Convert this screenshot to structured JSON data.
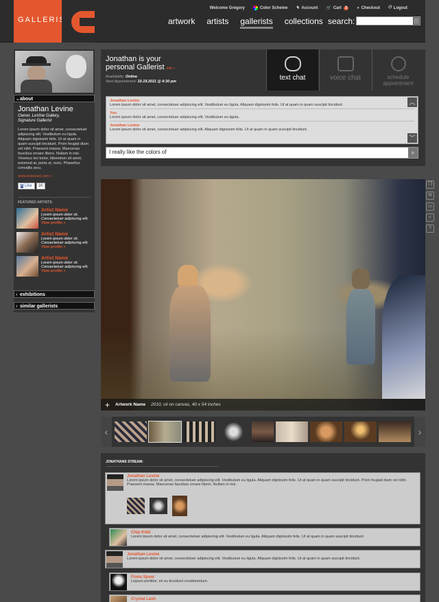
{
  "brand": {
    "name": "GALLERIST",
    "accent": "#e4572e"
  },
  "toplinks": {
    "welcome": "Welcome Gregory",
    "color_scheme": "Color Scheme",
    "account": "Account",
    "cart": "Cart",
    "cart_count": "3",
    "checkout": "Checkout",
    "logout": "Logout"
  },
  "nav": {
    "items": [
      "artwork",
      "artists",
      "gallerists",
      "collections"
    ],
    "active": "gallerists"
  },
  "search": {
    "label": "search:",
    "value": ""
  },
  "sidebar": {
    "about_label": "about",
    "name": "Jonathan Levine",
    "title_lines": [
      "Owner, LeVine Gallery,",
      "Signature Gallerist"
    ],
    "bio": "Lorem ipsum dolor sit amet, consectetuer adipiscing elit. Vestibulum eu ligula. Aliquam dignissim felis. Ut at quam in quam suscipit tincidunt. Proin feugiat diam vel nibh. Praesent massa. Maecenas faucibus ornare libero. Nullam in nisi. Vivamus leo tortor, bibendum sit amet, euismod at, porta ut, nunc. Phasellus convallis arcu.",
    "website": "www.levineart.com »",
    "fb_like": "Like",
    "fb_count": "1K",
    "featured_heading": "FEATURED ARTISTS:",
    "artists": [
      {
        "name": "Artist Name",
        "desc": "Lorem ipsum dolor sit. Consectetuer adipiscing elit.",
        "link": "View profile »"
      },
      {
        "name": "Artist Name",
        "desc": "Lorem ipsum dolor sit. Consectetuer adipiscing elit.",
        "link": "View profile »"
      },
      {
        "name": "Artist Name",
        "desc": "Lorem ipsum dolor sit. Consectetuer adipiscing elit.",
        "link": "View profile »"
      }
    ],
    "exhibitions_label": "exhibitions",
    "similar_label": "similar gallerists"
  },
  "chat": {
    "title_line1": "Jonathan is your",
    "title_line2": "personal Gallerist",
    "edit": "edit »",
    "availability_label": "Availability:",
    "availability_value": "Online",
    "next_label": "Next Appointment:",
    "next_value": "10.19.2011 @ 4:30 pm",
    "tabs": [
      "text chat",
      "voice chat",
      "schedule appointment"
    ],
    "messages": [
      {
        "who": "Jonathan Levine",
        "text": "Lorem ipsum dolor sit amet, consectetuer adipiscing elit. Vestibulum eu ligula. Aliquam dignissim felis. Ut at quam in quam suscipit tincidunt."
      },
      {
        "who": "You",
        "text": "Lorem ipsum dolor sit amet, consectetuer adipiscing elit. Vestibulum eu ligula."
      },
      {
        "who": "Jonathan Levine",
        "text": "Lorem ipsum dolor sit amet, consectetuer adipiscing elit. Aliquam dignissim felis. Ut at quam in quam suscipit tincidunt."
      }
    ],
    "input_value": "I really like the colors of"
  },
  "artwork": {
    "name": "Artwork Name",
    "meta": "2010, oil on canvas, 40 x 54 inches"
  },
  "stream": {
    "heading": "JONATHANS STREAM:",
    "posts": [
      {
        "who": "Jonathan Levine",
        "text": "Lorem ipsum dolor sit amet, consectetuer adipiscing elit. Vestibulum eu ligula. Aliquam dignissim felis. Ut at quam in quam suscipit tincidunt. Proin feugiat diam vel nibh. Praesent massa. Maecenas faucibus ornare libero. Nullam in nisi."
      },
      {
        "who": "Chip Kidd",
        "text": "Lorem ipsum dolor sit amet, consectetuer adipiscing elit. Vestibulum eu ligula. Aliquam dignissim felis. Ut at quam in quam suscipit tincidunt."
      },
      {
        "who": "Jonathan Levine",
        "text": "Lorem ipsum dolor sit amet, consectetuer adipiscing elit. Vestibulum eu ligula. Aliquam dignissim felis. Ut at quam in quam suscipit tincidunt."
      },
      {
        "who": "Fiona Spear",
        "text": "Lispum porttitor, mi eu tincidunt condimentum."
      },
      {
        "who": "Crystal Lash",
        "text": ""
      }
    ]
  }
}
